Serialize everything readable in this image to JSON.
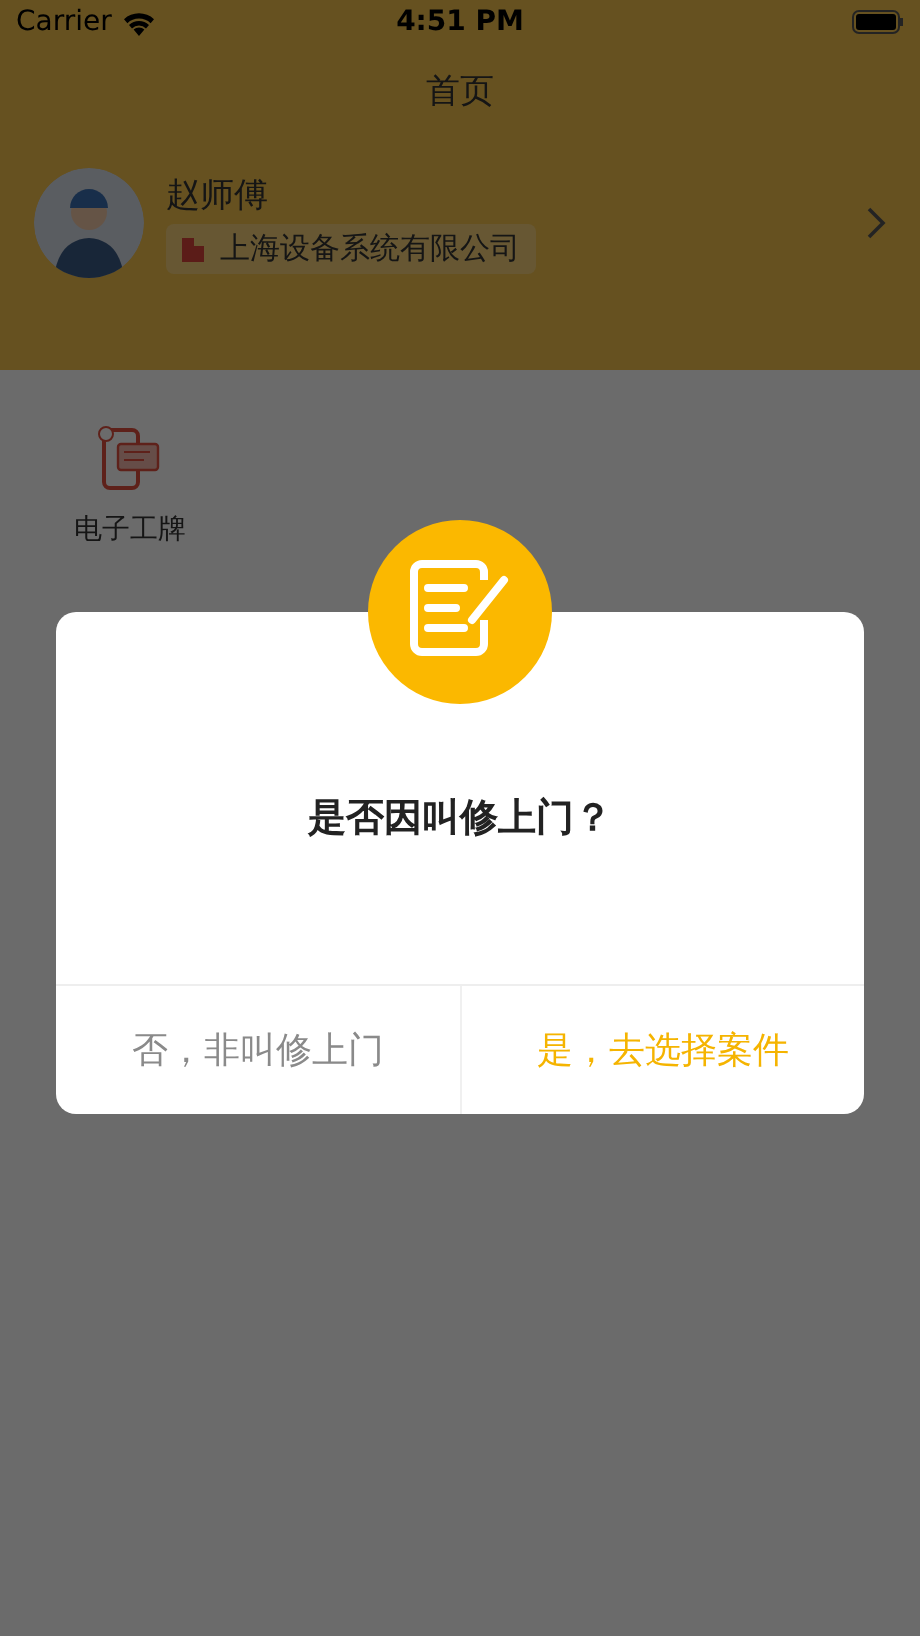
{
  "status_bar": {
    "carrier": "Carrier",
    "time": "4:51 PM"
  },
  "nav": {
    "title": "首页"
  },
  "profile": {
    "name": "赵师傅",
    "company": "上海设备系统有限公司"
  },
  "grid": [
    {
      "label": "电子工牌"
    }
  ],
  "dialog": {
    "message": "是否因叫修上门？",
    "buttons": [
      {
        "label": "否，非叫修上门",
        "kind": "cancel"
      },
      {
        "label": "是，去选择案件",
        "kind": "confirm"
      }
    ]
  }
}
